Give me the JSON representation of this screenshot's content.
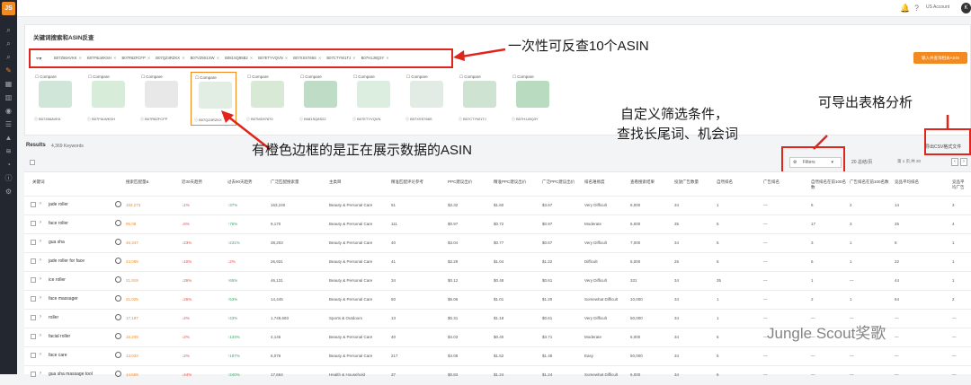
{
  "app": {
    "logo": "JS",
    "account": "US Account",
    "avatar": "K"
  },
  "sidebar": {
    "icons": [
      "search-icon",
      "search-icon",
      "search-icon",
      "wrench-icon",
      "table-icon",
      "bar-chart-icon",
      "eye-icon",
      "list-icon",
      "grad-cap-icon",
      "layers-icon",
      "chart-icon",
      "info-icon",
      "settings-icon"
    ]
  },
  "panel": {
    "title": "关键词搜索和ASIN反查",
    "asins": [
      "B07Z66AVKK",
      "B07F6LWKSH",
      "B07R8ZFCFP",
      "B07QZ4RZKX",
      "B07VZ9S1XW",
      "B081SQ85B2",
      "B07ETYVQVN",
      "B07XSS766S",
      "B07CTYW1TJ",
      "B07H1J8Q3Y"
    ],
    "add_button": "输入并查询相关ASIN",
    "compare_label": "Compare",
    "cards": [
      {
        "asin": "B07Z66AVKK",
        "color": "#cfe6d8"
      },
      {
        "asin": "B07F6LWKSH",
        "color": "#d7ecd9"
      },
      {
        "asin": "B07R8ZFCFP",
        "color": "#e8e8e8"
      },
      {
        "asin": "B07QZ4RZKX",
        "color": "#e2eee3"
      },
      {
        "asin": "B07MD97870",
        "color": "#d8ead6"
      },
      {
        "asin": "B081SQ8S22",
        "color": "#bfddc6"
      },
      {
        "asin": "B07ETYVQVN",
        "color": "#dceee0"
      },
      {
        "asin": "B07XSS766S",
        "color": "#e3ece4"
      },
      {
        "asin": "B07CTYW1TJ",
        "color": "#cfe3d2"
      },
      {
        "asin": "B07H1J8Q3Y",
        "color": "#b9dcc1"
      }
    ]
  },
  "annotations": {
    "asin_note": "一次性可反查10个ASIN",
    "orange_note": "有橙色边框的是正在展示数据的ASIN",
    "filter_note_1": "自定义筛选条件，",
    "filter_note_2": "查找长尾词、机会词",
    "export_note": "可导出表格分析"
  },
  "results": {
    "label": "Results",
    "count": "4,369 Keywords",
    "filters": "Filters",
    "page_size": "20 总结/页",
    "pager": "第  1  页,共 20",
    "export": "导出CSV格式文件"
  },
  "table": {
    "headers": [
      "关键词",
      "搜索匹配量&",
      "近30天趋势",
      "过去90天趋势",
      "广泛匹配搜索量",
      "主类目",
      "精准匹配评论参考",
      "PPC建议出价",
      "精准PPC建议出价",
      "广泛PPC建议出价",
      "排名难易度",
      "查看搜索结果",
      "投放广告数量",
      "自然排名",
      "广告排名",
      "自然排名在前100名数",
      "广告排名在前100名数",
      "竞品平均排名",
      "竞品平均广告"
    ],
    "rows": [
      {
        "kw": "jade roller",
        "v": [
          "163,273",
          "↓1%",
          "↑37%",
          "163,240",
          "Beauty & Personal Care",
          "51",
          "$2.32",
          "$1.60",
          "$3.67",
          "Very Difficult",
          "6,000",
          "34",
          "1",
          "—",
          "6",
          "2",
          "14",
          "3"
        ]
      },
      {
        "kw": "face roller",
        "v": [
          "95,08",
          "↓6%",
          "↑76%",
          "9,170",
          "Beauty & Personal Care",
          "111",
          "$0.97",
          "$0.72",
          "$0.97",
          "Moderate",
          "6,000",
          "35",
          "5",
          "—",
          "17",
          "3",
          "25",
          "4"
        ]
      },
      {
        "kw": "gua sha",
        "v": [
          "46,347",
          "↓23%",
          "↑231%",
          "38,203",
          "Beauty & Personal Care",
          "40",
          "$3.04",
          "$0.77",
          "$0.67",
          "Very Difficult",
          "7,000",
          "34",
          "5",
          "—",
          "3",
          "1",
          "8",
          "1"
        ]
      },
      {
        "kw": "jade roller for face",
        "v": [
          "24,099",
          "↓10%",
          "↓2%",
          "26,931",
          "Beauty & Personal Care",
          "41",
          "$2.29",
          "$1.04",
          "$1.22",
          "Difficult",
          "6,000",
          "26",
          "6",
          "—",
          "6",
          "1",
          "22",
          "1"
        ]
      },
      {
        "kw": "ice roller",
        "v": [
          "21,919",
          "↓26%",
          "↑65%",
          "46,131",
          "Beauty & Personal Care",
          "34",
          "$0.12",
          "$0.48",
          "$0.61",
          "Very Difficult",
          "331",
          "34",
          "35",
          "—",
          "1",
          "—",
          "44",
          "1"
        ]
      },
      {
        "kw": "face massager",
        "v": [
          "21,025",
          "↓26%",
          "↑53%",
          "14,445",
          "Beauty & Personal Care",
          "50",
          "$6.06",
          "$1.01",
          "$1.20",
          "Somewhat Difficult",
          "10,000",
          "34",
          "1",
          "—",
          "2",
          "1",
          "64",
          "2"
        ]
      },
      {
        "kw": "roller",
        "v": [
          "17,187",
          "↓4%",
          "↑43%",
          "1,749,693",
          "Sports & Outdoors",
          "13",
          "$0.31",
          "$1.18",
          "$0.61",
          "Very Difficult",
          "50,000",
          "34",
          "1",
          "—",
          "—",
          "—",
          "—",
          "—"
        ]
      },
      {
        "kw": "facial roller",
        "v": [
          "16,209",
          "↓2%",
          "↑134%",
          "4,145",
          "Beauty & Personal Care",
          "40",
          "$4.03",
          "$0.40",
          "$3.71",
          "Moderate",
          "6,000",
          "34",
          "6",
          "—",
          "—",
          "—",
          "—",
          "—"
        ]
      },
      {
        "kw": "face care",
        "v": [
          "13,033",
          "↓2%",
          "↑187%",
          "6,076",
          "Beauty & Personal Care",
          "217",
          "$4.08",
          "$1.52",
          "$1.48",
          "Easy",
          "50,000",
          "34",
          "5",
          "—",
          "—",
          "—",
          "—",
          "—"
        ]
      },
      {
        "kw": "gua sha massage tool",
        "v": [
          "14,669",
          "↓44%",
          "↑240%",
          "17,664",
          "Health & Household",
          "37",
          "$0.83",
          "$1.24",
          "$1.24",
          "Somewhat Difficult",
          "6,000",
          "34",
          "6",
          "—",
          "—",
          "—",
          "—",
          "—"
        ]
      }
    ]
  },
  "watermark": "Jungle Scout奖歌"
}
